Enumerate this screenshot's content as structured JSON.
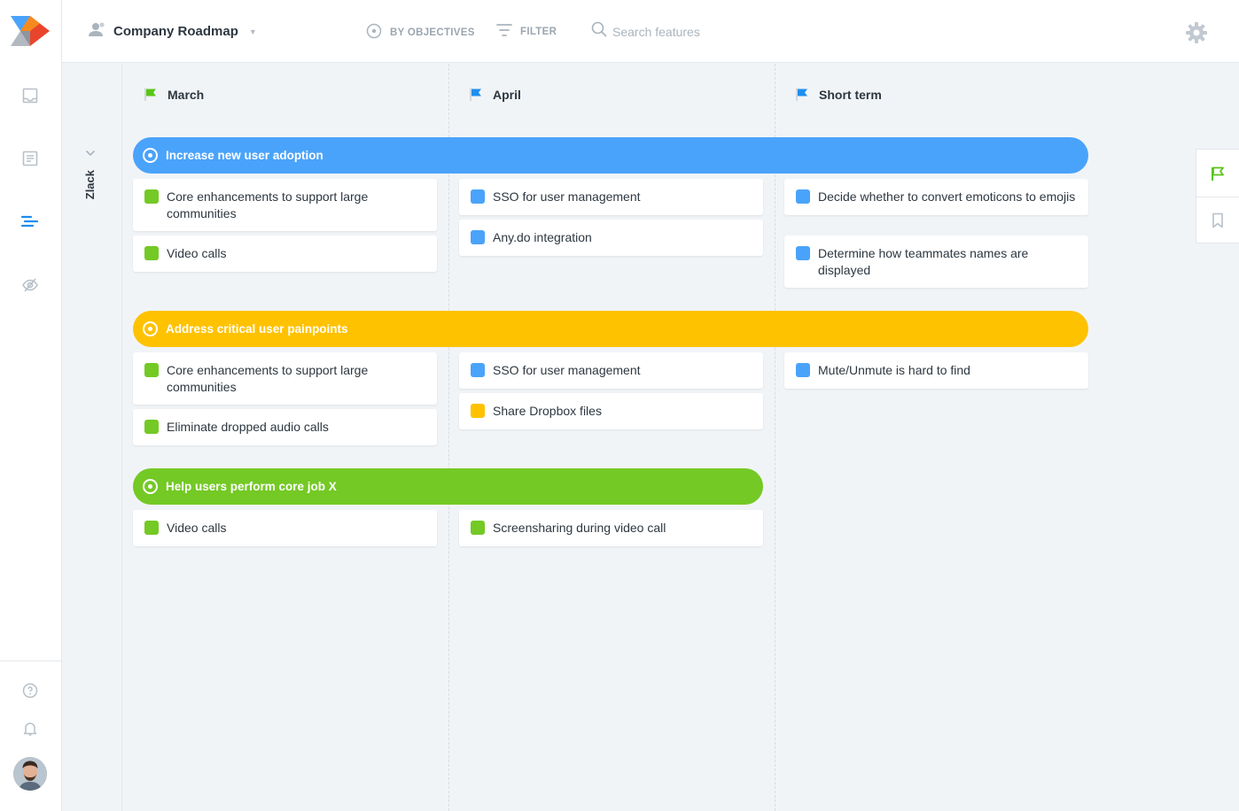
{
  "colors": {
    "green": "#74c925",
    "blue": "#4aa3fa",
    "yellow": "#ffc200",
    "flag_blue": "#1d8ef0",
    "flag_green": "#59c516"
  },
  "topbar": {
    "roadmap_title": "Company Roadmap",
    "by_objectives_label": "BY OBJECTIVES",
    "filter_label": "FILTER",
    "search_placeholder": "Search features"
  },
  "group": {
    "name": "Zlack"
  },
  "columns": [
    {
      "label": "March",
      "flag_color": "green"
    },
    {
      "label": "April",
      "flag_color": "blue"
    },
    {
      "label": "Short term",
      "flag_color": "blue"
    }
  ],
  "objectives": [
    {
      "label": "Increase new user adoption",
      "color": "blue",
      "cards": [
        [
          {
            "text": "Core enhancements to support large communities",
            "color": "green"
          },
          {
            "text": "Video calls",
            "color": "green"
          }
        ],
        [
          {
            "text": "SSO for user management",
            "color": "blue"
          },
          {
            "text": "Any.do integration",
            "color": "blue"
          }
        ],
        [
          {
            "text": "Decide whether to convert emoticons to emojis",
            "color": "blue"
          },
          {
            "text": "Determine how teammates names are displayed",
            "color": "blue"
          }
        ]
      ]
    },
    {
      "label": "Address critical user painpoints",
      "color": "yellow",
      "cards": [
        [
          {
            "text": "Core enhancements to support large communities",
            "color": "green"
          },
          {
            "text": "Eliminate dropped audio calls",
            "color": "green"
          }
        ],
        [
          {
            "text": "SSO for user management",
            "color": "blue"
          },
          {
            "text": "Share Dropbox files",
            "color": "yellow"
          }
        ],
        [
          {
            "text": "Mute/Unmute is hard to find",
            "color": "blue"
          }
        ]
      ]
    },
    {
      "label": "Help users perform core job X",
      "color": "green",
      "cards": [
        [
          {
            "text": "Video calls",
            "color": "green"
          }
        ],
        [
          {
            "text": "Screensharing during video call",
            "color": "green"
          }
        ]
      ]
    }
  ],
  "icons": {
    "nav": [
      "inbox-icon",
      "document-icon",
      "roadmap-icon",
      "hidden-eye-icon"
    ],
    "bottom_nav": [
      "help-icon",
      "bell-icon"
    ],
    "right_tabs": [
      "flag-icon",
      "bookmark-icon"
    ]
  }
}
